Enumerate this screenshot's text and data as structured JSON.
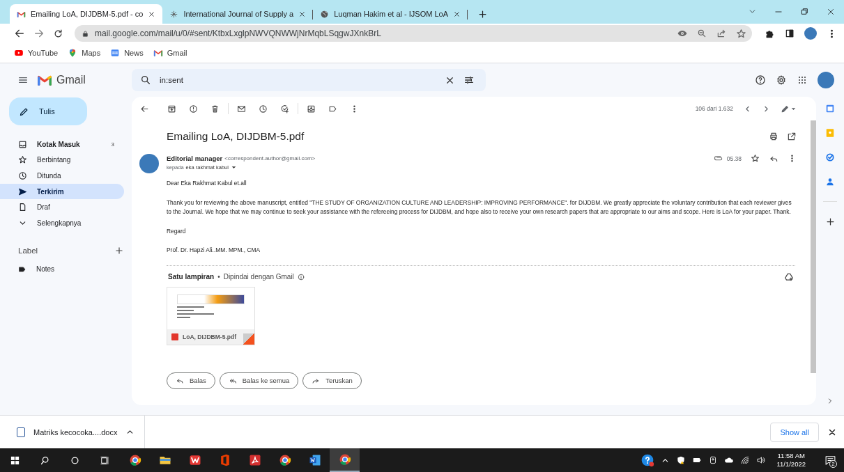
{
  "browser": {
    "tabs": [
      {
        "title": "Emailing LoA, DIJDBM-5.pdf - co",
        "selected": true
      },
      {
        "title": "International Journal of Supply a",
        "selected": false
      },
      {
        "title": "Luqman Hakim et al - IJSOM LoA",
        "selected": false
      }
    ],
    "url": "mail.google.com/mail/u/0/#sent/KtbxLxglpNWVQNWWjNrMqbLSqgwJXnkBrL",
    "bookmarks": [
      "YouTube",
      "Maps",
      "News",
      "Gmail"
    ]
  },
  "gmail": {
    "logo": "Gmail",
    "search": {
      "value": "in:sent"
    },
    "compose": "Tulis",
    "nav": [
      {
        "label": "Kotak Masuk",
        "count": "3",
        "unread": true,
        "selected": false
      },
      {
        "label": "Berbintang",
        "unread": false,
        "selected": false
      },
      {
        "label": "Ditunda",
        "unread": false,
        "selected": false
      },
      {
        "label": "Terkirim",
        "unread": false,
        "selected": true
      },
      {
        "label": "Draf",
        "unread": false,
        "selected": false
      },
      {
        "label": "Selengkapnya",
        "unread": false,
        "selected": false
      }
    ],
    "labels_header": "Label",
    "labels": [
      {
        "name": "Notes"
      }
    ],
    "message": {
      "position": "106 dari 1.632",
      "subject": "Emailing LoA, DIJDBM-5.pdf",
      "sender_name": "Editorial manager",
      "sender_email": "<correspondent.author@gmail.com>",
      "to_prefix": "kepada",
      "to": "eka rakhmat kabul",
      "time": "05.38",
      "starred": false,
      "body": [
        "Dear Eka Rakhmat Kabul et.all",
        "Thank you for reviewing the above manuscript, entitled \"THE STUDY OF ORGANIZATION CULTURE AND LEADERSHIP: IMPROVING PERFORMANCE\". for DIJDBM. We greatly appreciate the voluntary contribution that each reviewer gives to the Journal. We hope that we may continue to seek your assistance with the refereeing process for DIJDBM, and hope also to receive your own research papers that are appropriate to our aims and scope. Here is LoA for your paper. Thank.",
        "Regard",
        "Prof. Dr. Hapzi Ali..MM. MPM., CMA"
      ],
      "attachments_title": "Satu lampiran",
      "attachments_separator": "•",
      "scan_note": "Dipindai dengan Gmail",
      "attachments": [
        {
          "name": "LoA, DIJDBM-5.pdf"
        }
      ],
      "actions": [
        "Balas",
        "Balas ke semua",
        "Teruskan"
      ]
    }
  },
  "downloads": {
    "items": [
      {
        "name": "Matriks kecocoka....docx"
      }
    ],
    "show_all": "Show all"
  },
  "taskbar": {
    "apps": [
      {
        "selected": false
      },
      {
        "selected": false
      },
      {
        "selected": false
      },
      {
        "selected": false
      },
      {
        "selected": false
      },
      {
        "selected": false
      },
      {
        "selected": false
      },
      {
        "selected": true
      }
    ],
    "time": "11:58 AM",
    "date": "11/1/2022",
    "notifications": "2"
  }
}
